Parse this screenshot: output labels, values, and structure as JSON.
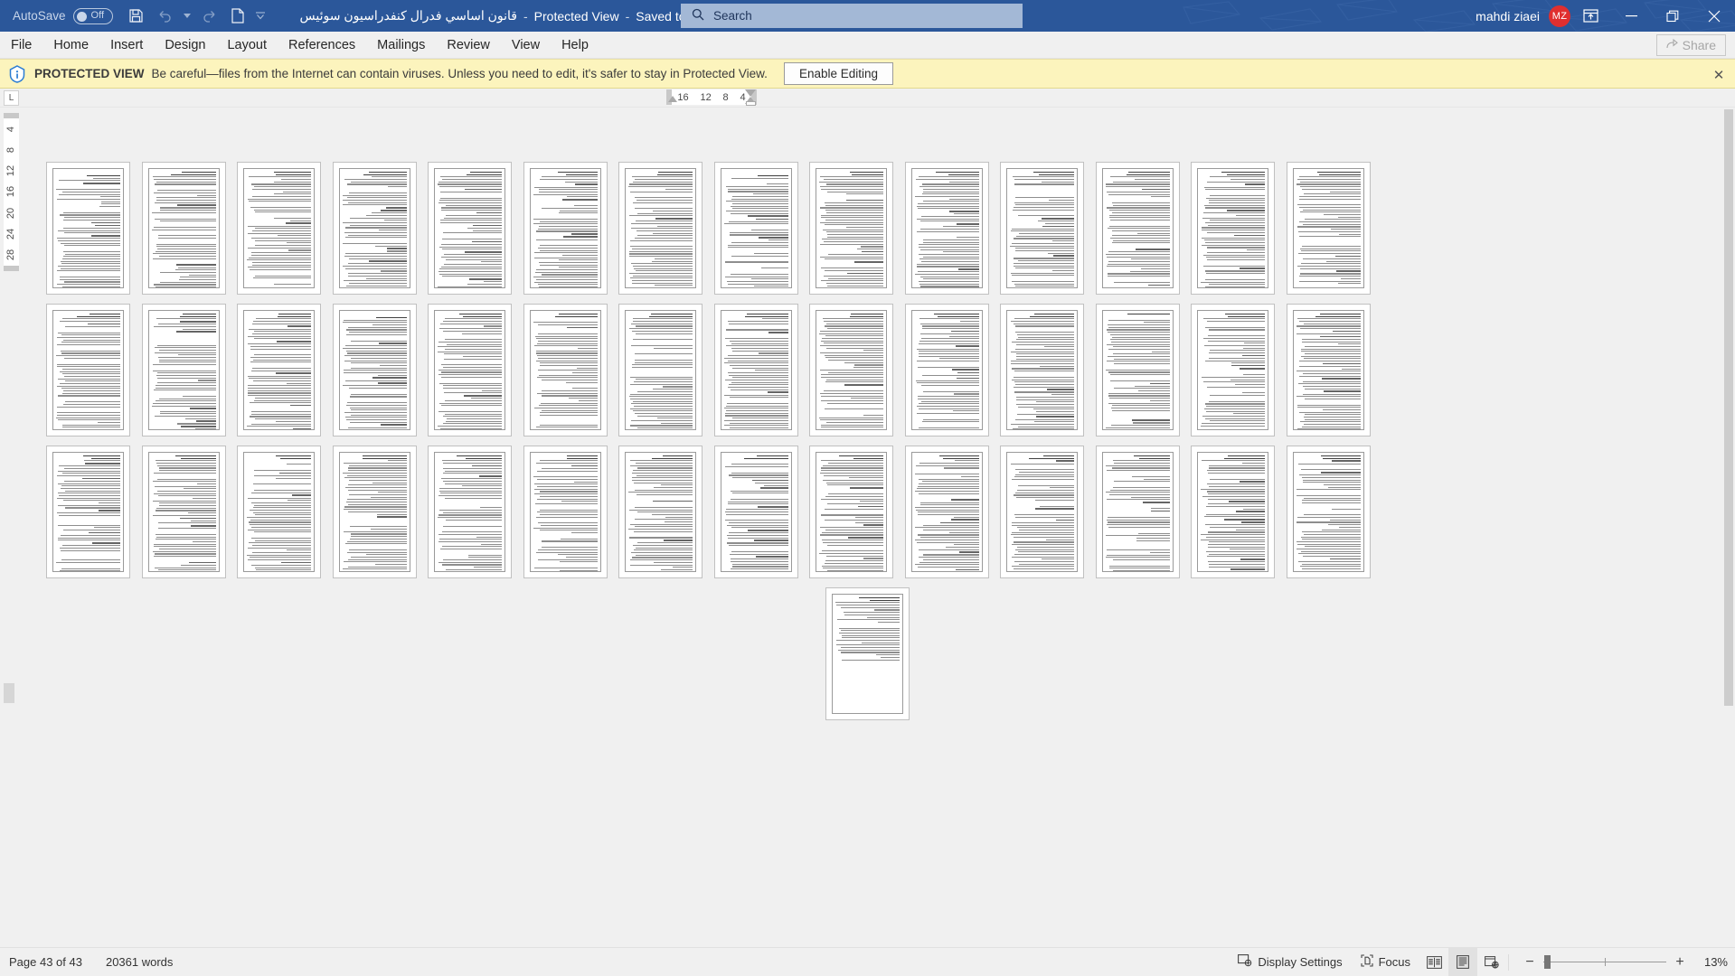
{
  "titlebar": {
    "autosave_label": "AutoSave",
    "autosave_state": "Off",
    "quick_access": [
      {
        "name": "save-icon",
        "label": "Save"
      },
      {
        "name": "undo-icon",
        "label": "Undo"
      },
      {
        "name": "undo-dropdown-icon",
        "label": "Undo options"
      },
      {
        "name": "redo-icon",
        "label": "Redo"
      },
      {
        "name": "new-document-icon",
        "label": "New"
      },
      {
        "name": "customize-quick-access-toolbar-icon",
        "label": "Customize Quick Access Toolbar"
      }
    ],
    "document_title": "قانون اساسي فدرال كنفدراسيون سوئيس",
    "separator": "-",
    "protected_view": "Protected View",
    "save_location": "Saved to this PC",
    "title_dropdown": "▾",
    "search_placeholder": "Search",
    "search_value": "",
    "user_name": "mahdi ziaei",
    "user_initials": "MZ",
    "ribbon_display_options": "ribbon-display-options",
    "minimize": "minimize",
    "restore": "restore",
    "close": "close"
  },
  "ribbon": {
    "tabs": [
      {
        "label": "File",
        "active": false
      },
      {
        "label": "Home",
        "active": false
      },
      {
        "label": "Insert",
        "active": false
      },
      {
        "label": "Design",
        "active": false
      },
      {
        "label": "Layout",
        "active": false
      },
      {
        "label": "References",
        "active": false
      },
      {
        "label": "Mailings",
        "active": false
      },
      {
        "label": "Review",
        "active": false
      },
      {
        "label": "View",
        "active": false
      },
      {
        "label": "Help",
        "active": false
      }
    ],
    "share_label": "Share"
  },
  "protected_view_bar": {
    "icon": "shield-info-icon",
    "strong": "PROTECTED VIEW",
    "message": "Be careful—files from the Internet can contain viruses. Unless you need to edit, it's safer to stay in Protected View.",
    "button_label": "Enable Editing",
    "close_label": "✕",
    "bg_color": "#fcf4bd"
  },
  "ruler": {
    "tab_stop_marker": "L",
    "horizontal_ticks": [
      "16",
      "12",
      "8",
      "4"
    ],
    "vertical_ticks": [
      "4",
      "8",
      "12",
      "16",
      "20",
      "24",
      "28"
    ]
  },
  "document": {
    "zoom_percent": 13,
    "total_pages": 43,
    "rows": [
      {
        "count": 14
      },
      {
        "count": 14
      },
      {
        "count": 14
      },
      {
        "count": 1
      }
    ]
  },
  "statusbar": {
    "page_status": "Page 43 of 43",
    "word_count": "20361 words",
    "display_settings": "Display Settings",
    "focus": "Focus",
    "view_read_mode": "read-mode-icon",
    "view_print_layout": "print-layout-icon",
    "view_web_layout": "web-layout-icon",
    "zoom_out": "−",
    "zoom_in": "+",
    "zoom_label": "13%"
  },
  "colors": {
    "word_blue": "#2b579a",
    "accent_red": "#e02f2f",
    "protected_yellow": "#fcf4bd",
    "chrome_gray": "#f0f0f0"
  }
}
